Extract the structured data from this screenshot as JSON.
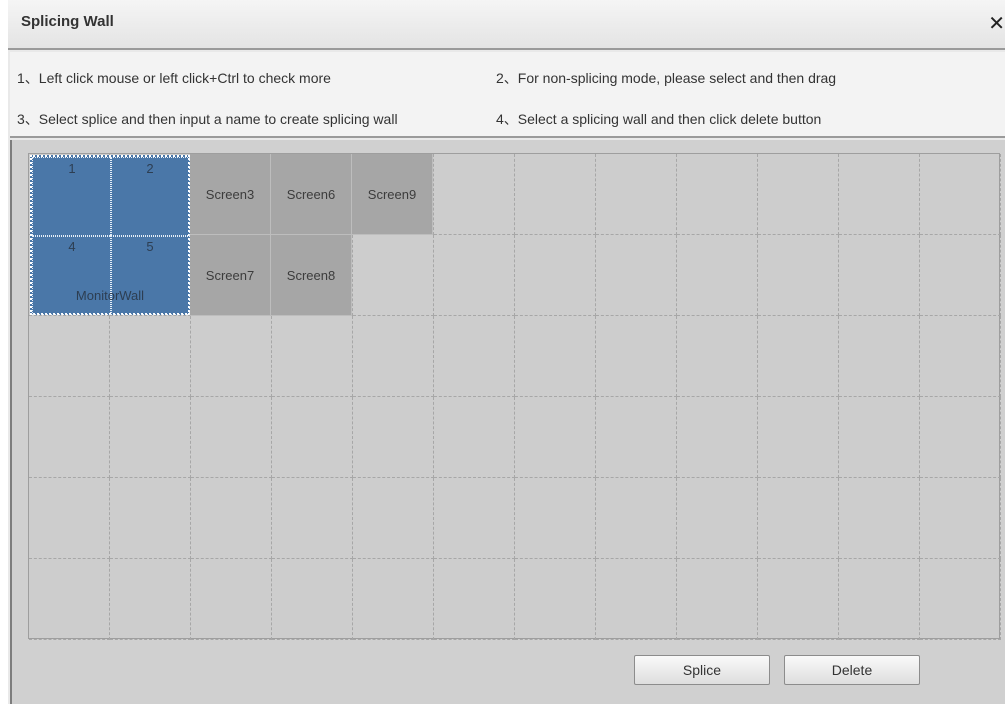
{
  "window": {
    "title": "Splicing Wall",
    "close_symbol": "✕"
  },
  "tips": {
    "tip1": "1、Left click mouse or left click+Ctrl to check more",
    "tip2": "2、For non-splicing mode, please select and then drag",
    "tip3": "3、Select splice and then input a name to create splicing wall",
    "tip4": "4、Select a splicing wall and then click delete button"
  },
  "grid": {
    "rows": 6,
    "cols": 12,
    "splicing_wall": {
      "name": "MonitorWall",
      "screens": [
        "1",
        "2",
        "4",
        "5"
      ],
      "color": "#4a77a8"
    },
    "free_screens": [
      "Screen3",
      "Screen6",
      "Screen9",
      "Screen7",
      "Screen8"
    ]
  },
  "buttons": {
    "splice": "Splice",
    "delete": "Delete"
  }
}
